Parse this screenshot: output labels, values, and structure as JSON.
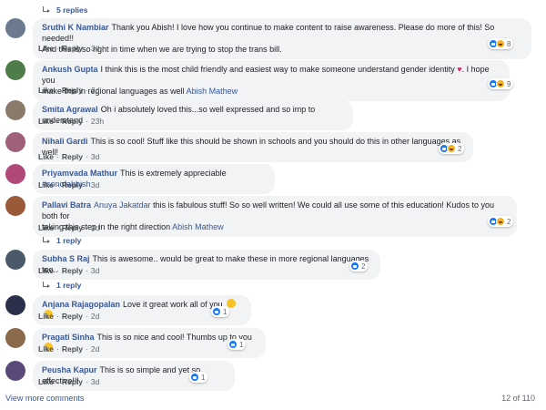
{
  "top_replies": {
    "label": "5 replies"
  },
  "comments": [
    {
      "name": "Sruthi K Nambiar",
      "text": "Thank you Abish! I love how you continue to make content to raise awareness. Please do more of this! So needed!!",
      "text2": "And this is so right in time when we are trying to stop the trans bill.",
      "like": "Like",
      "reply": "Reply",
      "time": "3d",
      "reaction_count": "8",
      "avatar_color": "#6b7a8f"
    },
    {
      "name": "Ankush Gupta",
      "text": "I think this is the most child friendly and easiest way to make someone understand gender identity",
      "text_after_heart": ". I hope you",
      "text2": "make this in regional languages as well",
      "mention": "Abish Mathew",
      "like": "Like",
      "reply": "Reply",
      "time": "2d",
      "reaction_count": "9",
      "avatar_color": "#4f7d4a"
    },
    {
      "name": "Smita Agrawal",
      "text": "Oh i absolutely loved this...so well expressed and so imp to understand",
      "like": "Like",
      "reply": "Reply",
      "time": "23h",
      "avatar_color": "#8a7a6a"
    },
    {
      "name": "Nihali Gardi",
      "text": "This is so cool! Stuff like this should be shown in schools and you should do this in other languages as well!",
      "like": "Like",
      "reply": "Reply",
      "time": "3d",
      "reaction_count": "2",
      "avatar_color": "#a0607a"
    },
    {
      "name": "Priyamvada Mathur",
      "text": "This is extremely appreciable",
      "mention": "#sonofabhish",
      "like": "Like",
      "reply": "Reply",
      "time": "3d",
      "avatar_color": "#b0487a"
    },
    {
      "name": "Pallavi Batra",
      "mention_lead": "Anuya Jakatdar",
      "text": "this is fabulous stuff! So so well written! We could all use some of this education! Kudos to you both for",
      "text2": "taking this step in the right direction",
      "mention": "Abish Mathew",
      "like": "Like",
      "reply": "Reply",
      "time": "3d",
      "reaction_count": "2",
      "avatar_color": "#9a5a3a"
    },
    {
      "name": "Subha S Raj",
      "text": "This is awesome.. would be great to make these in more regional languages too..",
      "like": "Like",
      "reply": "Reply",
      "time": "3d",
      "reaction_count": "2",
      "avatar_color": "#4a5a6a"
    },
    {
      "name": "Anjana Rajagopalan",
      "text": "Love it great work all of you",
      "like": "Like",
      "reply": "Reply",
      "time": "2d",
      "reaction_count": "1",
      "avatar_color": "#2a2f4a"
    },
    {
      "name": "Pragati Sinha",
      "text": "This is so nice and cool! Thumbs up to you",
      "like": "Like",
      "reply": "Reply",
      "time": "2d",
      "reaction_count": "1",
      "avatar_color": "#8a6a4a"
    },
    {
      "name": "Peusha Kapur",
      "text": "This is so simple and yet so effective!!!",
      "like": "Like",
      "reply": "Reply",
      "time": "3d",
      "reaction_count": "1",
      "avatar_color": "#5a4a7a"
    }
  ],
  "reply_links": [
    {
      "label": "1 reply"
    },
    {
      "label": "1 reply"
    }
  ],
  "footer": {
    "view_more": "View more comments",
    "count": "12 of 110"
  }
}
